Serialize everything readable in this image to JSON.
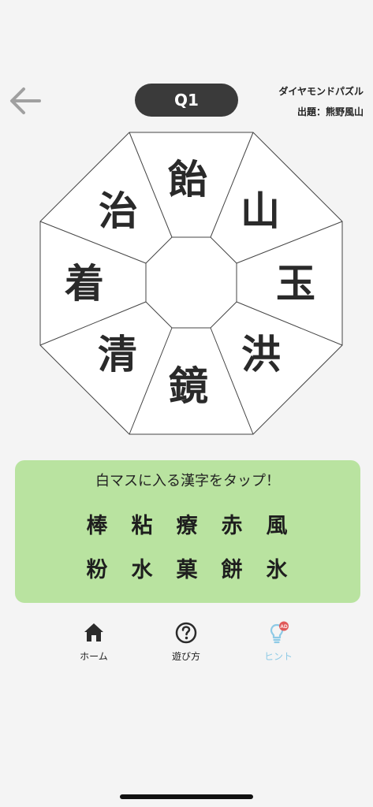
{
  "header": {
    "question_label": "Q1",
    "puzzle_type": "ダイヤモンドパズル",
    "author": "出題：熊野風山"
  },
  "board": {
    "cells": [
      "飴",
      "山",
      "玉",
      "洪",
      "鏡",
      "清",
      "着",
      "治"
    ]
  },
  "panel": {
    "instruction": "白マスに入る漢字をタップ！",
    "choices": [
      "棒",
      "粘",
      "療",
      "赤",
      "風",
      "粉",
      "水",
      "菓",
      "餅",
      "氷"
    ],
    "background_color": "#b9e3a0"
  },
  "nav": {
    "items": [
      {
        "label": "ホーム",
        "icon": "home-icon"
      },
      {
        "label": "遊び方",
        "icon": "help-circle-icon"
      },
      {
        "label": "ヒント",
        "icon": "lightbulb-ad-icon",
        "badge": "AD",
        "color": "#8ecae6"
      }
    ]
  }
}
